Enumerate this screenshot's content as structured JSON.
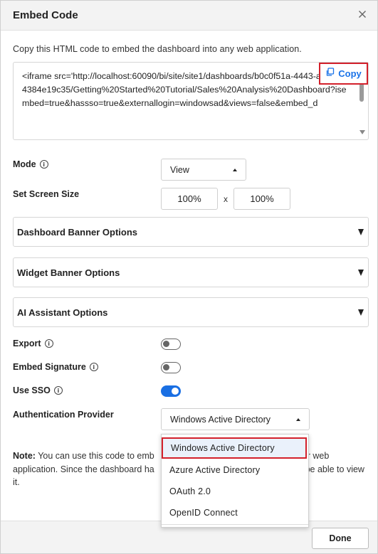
{
  "dialog": {
    "title": "Embed Code",
    "description": "Copy this HTML code to embed the dashboard into any web application.",
    "code": "<iframe src='http://localhost:60090/bi/site/site1/dashboards/b0c0f51a-4443-ac6c-874384e19c35/Getting%20Started%20Tutorial/Sales%20Analysis%20Dashboard?isembed=true&hassso=true&externallogin=windowsad&views=false&embed_d",
    "copy_label": "Copy"
  },
  "form": {
    "mode_label": "Mode",
    "mode_value": "View",
    "screen_size_label": "Set Screen Size",
    "width_value": "100%",
    "height_value": "100%",
    "size_separator": "x",
    "accordions": [
      {
        "label": "Dashboard Banner Options"
      },
      {
        "label": "Widget Banner Options"
      },
      {
        "label": "AI Assistant Options"
      }
    ],
    "export_label": "Export",
    "export_on": false,
    "embed_signature_label": "Embed Signature",
    "embed_signature_on": false,
    "use_sso_label": "Use SSO",
    "use_sso_on": true,
    "auth_provider_label": "Authentication Provider",
    "auth_provider_value": "Windows Active Directory"
  },
  "note": {
    "label": "Note:",
    "text_before": " You can use this code to emb",
    "text_after": "ur web application. Since the dashboard ha",
    "text_end": "ill be able to view it."
  },
  "dropdown": {
    "options": [
      "Windows Active Directory",
      "Azure Active Directory",
      "OAuth 2.0",
      "OpenID Connect"
    ],
    "selected": "Windows Active Directory"
  },
  "footer": {
    "done_label": "Done"
  },
  "colors": {
    "accent": "#1a6fe3",
    "highlight_border": "#d3202b"
  }
}
